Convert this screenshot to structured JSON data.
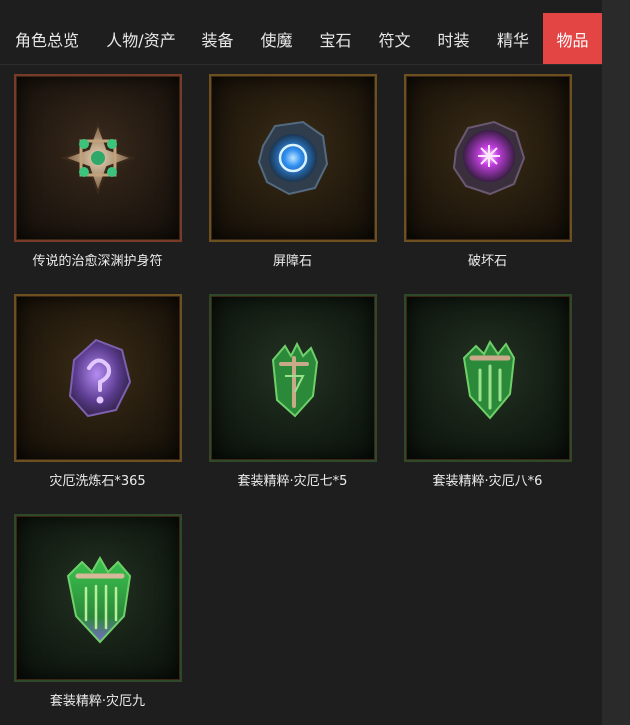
{
  "tabs": [
    {
      "label": "角色总览",
      "active": false
    },
    {
      "label": "人物/资产",
      "active": false
    },
    {
      "label": "装备",
      "active": false
    },
    {
      "label": "使魔",
      "active": false
    },
    {
      "label": "宝石",
      "active": false
    },
    {
      "label": "符文",
      "active": false
    },
    {
      "label": "时装",
      "active": false
    },
    {
      "label": "精华",
      "active": false
    },
    {
      "label": "物品",
      "active": true
    }
  ],
  "items": [
    {
      "name": "传说的治愈深渊护身符",
      "icon": "amulet-icon",
      "rarity": "legendary"
    },
    {
      "name": "屏障石",
      "icon": "blue-stone-icon",
      "rarity": "rare"
    },
    {
      "name": "破坏石",
      "icon": "purple-stone-icon",
      "rarity": "rare"
    },
    {
      "name": "灾厄洗炼石*365",
      "icon": "purple-rune-stone-icon",
      "rarity": "rare"
    },
    {
      "name": "套装精粹·灾厄七*5",
      "icon": "set-essence-7-icon",
      "rarity": "set"
    },
    {
      "name": "套装精粹·灾厄八*6",
      "icon": "set-essence-8-icon",
      "rarity": "set"
    },
    {
      "name": "套装精粹·灾厄九",
      "icon": "set-essence-9-icon",
      "rarity": "set"
    }
  ],
  "colors": {
    "active_tab": "#e34545",
    "background": "#1e1e1e",
    "legendary_frame": "#7a3a28",
    "rare_frame": "#6c5020",
    "set_frame": "#30482a"
  }
}
